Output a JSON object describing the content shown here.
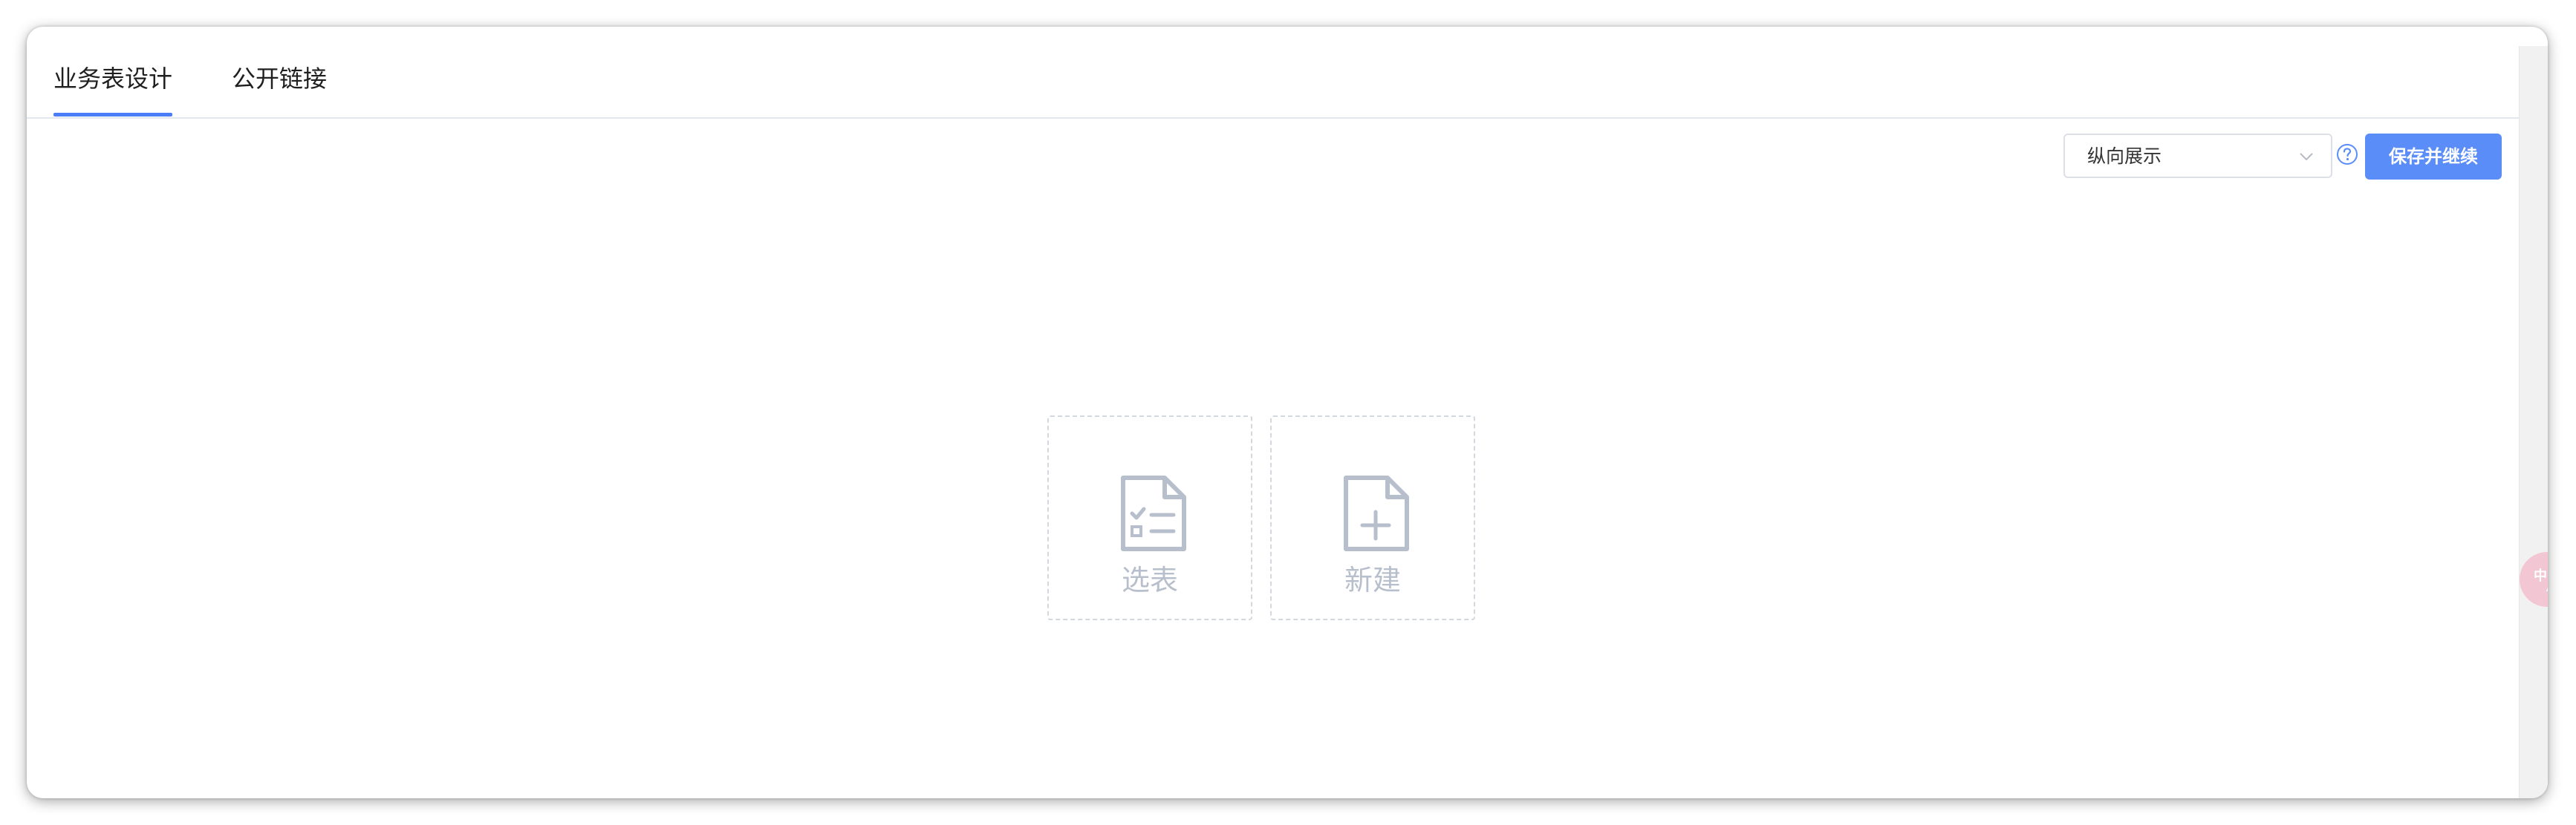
{
  "tabs": [
    {
      "label": "业务表设计",
      "active": true
    },
    {
      "label": "公开链接",
      "active": false
    }
  ],
  "toolbar": {
    "layout_select_value": "纵向展示",
    "save_label": "保存并继续"
  },
  "empty_state": {
    "pick_label": "选表",
    "create_label": "新建"
  },
  "icons": {
    "help": "question-circle-icon",
    "chevron": "chevron-down-icon",
    "pick": "checklist-document-icon",
    "create": "add-document-icon",
    "translate": "translate-icon"
  },
  "colors": {
    "accent": "#4a7df7",
    "primary_button": "#5b8df9",
    "placeholder_gray": "#b8bfcc"
  }
}
